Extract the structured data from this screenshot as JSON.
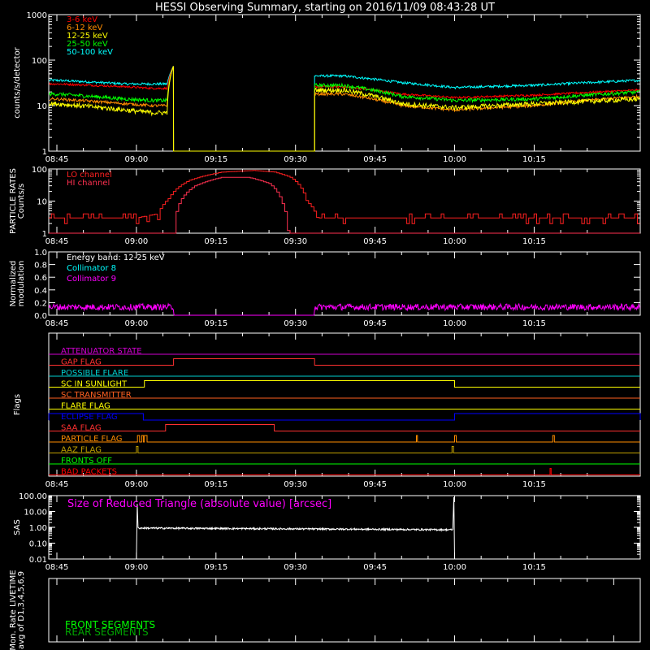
{
  "title": "HESSI Observing Summary, starting on 2016/11/09 08:43:28 UT",
  "time_axis": {
    "start_min": 523.47,
    "end_min": 635.0,
    "tick_labels": [
      "08:45",
      "09:00",
      "09:15",
      "09:30",
      "09:45",
      "10:00",
      "10:15"
    ],
    "tick_minutes": [
      525,
      540,
      555,
      570,
      585,
      600,
      615
    ]
  },
  "colors": {
    "3-6": "#ff0000",
    "6-12": "#ff8c00",
    "12-25": "#ffff00",
    "25-50": "#00ff00",
    "50-100": "#00ffff",
    "magenta": "#ff00ff",
    "white": "#ffffff",
    "front": "#00ff00",
    "rear": "#00aa00"
  },
  "chart_data": [
    {
      "type": "line",
      "id": "count_rates",
      "ylabel": "counts/s/detector",
      "yscale": "log",
      "ylim": [
        1,
        1000
      ],
      "ytick_labels": [
        "1",
        "10",
        "100",
        "1000"
      ],
      "legend": [
        "3-6 keV",
        "6-12 keV",
        "12-25 keV",
        "25-50 keV",
        "50-100 keV"
      ],
      "series": [
        {
          "name": "3-6 keV",
          "key": "3-6",
          "start": [
            [
              525,
              30
            ],
            [
              538,
              26
            ],
            [
              543,
              24
            ]
          ],
          "end": [
            [
              579,
              26
            ],
            [
              590,
              18
            ],
            [
              600,
              15
            ],
            [
              615,
              17
            ],
            [
              635,
              22
            ]
          ]
        },
        {
          "name": "6-12 keV",
          "key": "6-12",
          "start": [
            [
              525,
              14
            ],
            [
              538,
              11
            ],
            [
              543,
              10
            ]
          ],
          "end": [
            [
              579,
              18
            ],
            [
              590,
              10
            ],
            [
              600,
              8
            ],
            [
              615,
              10
            ],
            [
              635,
              16
            ]
          ]
        },
        {
          "name": "12-25 keV",
          "key": "12-25",
          "start": [
            [
              525,
              11
            ],
            [
              538,
              8
            ],
            [
              543,
              7
            ]
          ],
          "end": [
            [
              579,
              22
            ],
            [
              590,
              11
            ],
            [
              600,
              9
            ],
            [
              615,
              11
            ],
            [
              635,
              14
            ]
          ]
        },
        {
          "name": "25-50 keV",
          "key": "25-50",
          "start": [
            [
              525,
              18
            ],
            [
              538,
              14
            ],
            [
              543,
              13
            ]
          ],
          "end": [
            [
              579,
              28
            ],
            [
              590,
              16
            ],
            [
              600,
              13
            ],
            [
              615,
              14
            ],
            [
              635,
              20
            ]
          ]
        },
        {
          "name": "50-100 keV",
          "key": "50-100",
          "start": [
            [
              525,
              36
            ],
            [
              538,
              30
            ],
            [
              543,
              30
            ]
          ],
          "end": [
            [
              579,
              45
            ],
            [
              590,
              32
            ],
            [
              600,
              25
            ],
            [
              615,
              28
            ],
            [
              635,
              36
            ]
          ]
        }
      ],
      "gap": [
        547.0,
        573.6
      ],
      "spike_value": 75
    },
    {
      "type": "line",
      "id": "particle_rates",
      "ylabel": "PARTICLE RATES Counts/s",
      "yscale": "log",
      "ylim": [
        1,
        100
      ],
      "ytick_labels": [
        "1",
        "10",
        "100"
      ],
      "legend": [
        "LO channel",
        "HI channel"
      ],
      "series": [
        {
          "name": "LO channel",
          "points": [
            [
              523.5,
              3
            ],
            [
              540,
              3
            ],
            [
              544,
              4
            ],
            [
              546,
              12
            ],
            [
              550,
              45
            ],
            [
              556,
              80
            ],
            [
              562,
              90
            ],
            [
              566,
              80
            ],
            [
              569,
              55
            ],
            [
              572,
              10
            ],
            [
              574,
              3
            ],
            [
              635,
              3
            ]
          ]
        },
        {
          "name": "HI channel",
          "points": [
            [
              523.5,
              1
            ],
            [
              547,
              1
            ],
            [
              547.5,
              5
            ],
            [
              551,
              30
            ],
            [
              556,
              55
            ],
            [
              561,
              55
            ],
            [
              565,
              35
            ],
            [
              567.5,
              8
            ],
            [
              568.5,
              1
            ],
            [
              635,
              1
            ]
          ]
        }
      ]
    },
    {
      "type": "line",
      "id": "modulation",
      "ylabel": "Normalized modulation",
      "ylim": [
        0,
        1
      ],
      "ytick_labels": [
        "0.0",
        "0.2",
        "0.4",
        "0.6",
        "0.8",
        "1.0"
      ],
      "legend": [
        "Energy band: 12-25 keV",
        "Collimator 8",
        "Collimator 9"
      ],
      "series": [
        {
          "name": "Collimator 9",
          "value": 0.13,
          "noise": 0.05,
          "gap": [
            547.0,
            573.6
          ]
        }
      ]
    },
    {
      "type": "line",
      "id": "flags",
      "ylabel": "Flags",
      "series": [
        {
          "name": "ATTENUATOR STATE",
          "color": "#d000d0",
          "transitions": []
        },
        {
          "name": "GAP FLAG",
          "color": "#ff3030",
          "transitions": [
            [
              547.0,
              573.6
            ]
          ]
        },
        {
          "name": "POSSIBLE FLARE",
          "color": "#00d0d0",
          "transitions": []
        },
        {
          "name": "SC IN SUNLIGHT",
          "color": "#ffff00",
          "transitions": [
            [
              541.5,
              600.0
            ]
          ]
        },
        {
          "name": "SC TRANSMITTER",
          "color": "#ff6020",
          "transitions": []
        },
        {
          "name": "FLARE FLAG",
          "color": "#ffff00",
          "transitions": []
        },
        {
          "name": "ECLIPSE FLAG",
          "color": "#0000ff",
          "transitions": [
            [
              523.5,
              541.3
            ],
            [
              600.0,
              635
            ]
          ]
        },
        {
          "name": "SAA FLAG",
          "color": "#ff3030",
          "transitions": [
            [
              545.5,
              566.0
            ]
          ]
        },
        {
          "name": "PARTICLE FLAG",
          "color": "#ff8c00",
          "transitions": [
            [
              540.2,
              540.6
            ],
            [
              541.0,
              541.3
            ],
            [
              541.5,
              542.0
            ],
            [
              592.8,
              593.0
            ],
            [
              600.0,
              600.3
            ],
            [
              618.5,
              618.8
            ]
          ]
        },
        {
          "name": "AAZ FLAG",
          "color": "#c0a000",
          "transitions": [
            [
              540.0,
              540.3
            ],
            [
              599.5,
              599.8
            ]
          ]
        },
        {
          "name": "FRONTS OFF",
          "color": "#00ff00",
          "transitions": []
        },
        {
          "name": "BAD PACKETS",
          "color": "#ff0000",
          "transitions": [
            [
              618.0,
              618.2
            ]
          ]
        }
      ]
    },
    {
      "type": "line",
      "id": "sas",
      "ylabel": "SAS",
      "yscale": "log",
      "ylim": [
        0.01,
        100
      ],
      "ytick_labels": [
        "0.01",
        "0.10",
        "1.00",
        "10.00",
        "100.00"
      ],
      "annotation": "Size of Reduced Triangle (absolute value) [arcsec]",
      "series": [
        {
          "name": "Size of Reduced Triangle (absolute value) [arcsec]",
          "range": [
            540.0,
            600.0
          ],
          "start": 0.9,
          "end": 0.7,
          "noise": 0.12,
          "spike_start": 30,
          "spike_end": 80
        }
      ]
    },
    {
      "type": "line",
      "id": "livetime",
      "ylabel": "Mon. Rate LIVETIME avg of D1,3,4,5,6,9",
      "legend": [
        "FRONT SEGMENTS",
        "REAR SEGMENTS"
      ],
      "series": []
    }
  ]
}
